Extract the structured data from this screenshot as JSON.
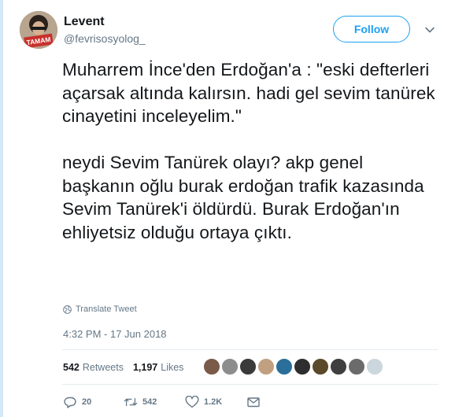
{
  "author": {
    "name": "Levent",
    "handle": "@fevrisosyolog_",
    "avatar_overlay_text": "TAMAM"
  },
  "follow_button_label": "Follow",
  "tweet": {
    "paragraphs": [
      "Muharrem İnce'den Erdoğan'a : \"eski defterleri açarsak altında kalırsın. hadi gel sevim tanürek cinayetini inceleyelim.\"",
      "neydi Sevim Tanürek olayı? akp genel başkanın oğlu burak erdoğan trafik kazasında Sevim Tanürek'i öldürdü. Burak Erdoğan'ın ehliyetsiz olduğu ortaya çıktı."
    ],
    "translate_label": "Translate Tweet",
    "timestamp": "4:32 PM - 17 Jun 2018"
  },
  "stats": {
    "retweets_count": "542",
    "retweets_label": "Retweets",
    "likes_count": "1,197",
    "likes_label": "Likes"
  },
  "liker_avatar_colors": [
    "#7a5a48",
    "#8d8d8d",
    "#3a3a3a",
    "#c0a080",
    "#2a6f9a",
    "#2e2e2e",
    "#5a4a2a",
    "#3f3f3f",
    "#6b6b6b",
    "#ccd6dd"
  ],
  "actions": {
    "replies": "20",
    "retweets": "542",
    "likes": "1.2K"
  },
  "colors": {
    "accent": "#1da1f2",
    "secondary_text": "#657786",
    "primary_text": "#14171a",
    "divider": "#e6ecf0"
  }
}
